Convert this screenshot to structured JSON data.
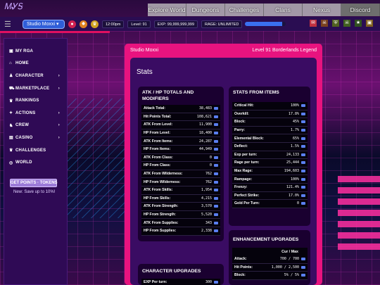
{
  "banner": {
    "logo": "ᎷᎽᎦ"
  },
  "topnav": [
    "Explore World",
    "Dungeons",
    "Challenges",
    "Clans",
    "Nexus",
    "Discord"
  ],
  "header": {
    "studio": "Studio Moxxi ▾",
    "time": "12:00pm",
    "level": "Level: 91",
    "exp": "EXP: 99,999,999,999",
    "rage": "RAGE: UNLIMITED",
    "rage_fill": 0.9
  },
  "sidebar": {
    "items": [
      {
        "icon": "▣",
        "label": "MY RGA",
        "chevron": ""
      },
      {
        "icon": "⌂",
        "label": "HOME",
        "chevron": ""
      },
      {
        "icon": "♟",
        "label": "CHARACTER",
        "chevron": "›"
      },
      {
        "icon": "⛟",
        "label": "MARKETPLACE",
        "chevron": "›"
      },
      {
        "icon": "♛",
        "label": "RANKINGS",
        "chevron": ""
      },
      {
        "icon": "✦",
        "label": "ACTIONS",
        "chevron": "›"
      },
      {
        "icon": "♞",
        "label": "CREW",
        "chevron": "›"
      },
      {
        "icon": "▤",
        "label": "CASINO",
        "chevron": "›"
      },
      {
        "icon": "♛",
        "label": "CHALLENGES",
        "chevron": ""
      },
      {
        "icon": "◎",
        "label": "WORLD",
        "chevron": ""
      }
    ],
    "points_button": "GET POINTS · TOKENS",
    "save_text": "New: Save up to 10%!"
  },
  "main": {
    "studio_name": "Studio Moxxi",
    "level_line": "Level 91 Borderlands Legend",
    "stats_title": "Stats",
    "atk_card": {
      "title_line1": "ATK / HP TOTALS AND",
      "title_line2": "MODIFIERS",
      "rows": [
        {
          "label": "Attack Total:",
          "value": "38,483"
        },
        {
          "label": "Hit Points Total:",
          "value": "108,621"
        },
        {
          "label": "ATK From Level:",
          "value": "11,900"
        },
        {
          "label": "HP From Level:",
          "value": "18,400"
        },
        {
          "label": "ATK From Items:",
          "value": "24,287"
        },
        {
          "label": "HP From Items:",
          "value": "44,949"
        },
        {
          "label": "ATK From Class:",
          "value": "0"
        },
        {
          "label": "HP From Class:",
          "value": "0"
        },
        {
          "label": "ATK From Wilderness:",
          "value": "762"
        },
        {
          "label": "HP From Wilderness:",
          "value": "762"
        },
        {
          "label": "ATK From Skills:",
          "value": "1,954"
        },
        {
          "label": "HP From Skills:",
          "value": "4,215"
        },
        {
          "label": "ATK From Strength:",
          "value": "3,570"
        },
        {
          "label": "HP From Strength:",
          "value": "5,520"
        },
        {
          "label": "ATK From Supplies:",
          "value": "343"
        },
        {
          "label": "HP From Supplies:",
          "value": "2,338"
        }
      ]
    },
    "char_upgrades": {
      "title": "CHARACTER UPGRADES",
      "rows": [
        {
          "label": "EXP Per turn:",
          "value": "300"
        }
      ]
    },
    "items_card": {
      "title": "STATS FROM ITEMS",
      "rows": [
        {
          "label": "Critical Hit:",
          "value": "100%"
        },
        {
          "label": "Overkill:",
          "value": "17.8%"
        },
        {
          "label": "Block:",
          "value": "45%"
        },
        {
          "label": "Parry:",
          "value": "1.7%"
        },
        {
          "label": "Elemental Block:",
          "value": "65%"
        },
        {
          "label": "Deflect:",
          "value": "1.5%"
        },
        {
          "label": "Exp per turn:",
          "value": "24,133"
        },
        {
          "label": "Rage per turn:",
          "value": "25,444"
        },
        {
          "label": "Max Rage:",
          "value": "194,603"
        },
        {
          "label": "Rampage:",
          "value": "100%"
        },
        {
          "label": "Frenzy:",
          "value": "121.4%"
        },
        {
          "label": "Perfect Strike:",
          "value": "17.0%"
        },
        {
          "label": "Gold Per Turn:",
          "value": "0"
        }
      ]
    },
    "enh_card": {
      "title": "ENHANCEMENT UPGRADES",
      "col_header": "Cur / Max",
      "rows": [
        {
          "label": "Attack:",
          "value": "700 / 700"
        },
        {
          "label": "Hit Points:",
          "value": "1,000 / 2,500"
        },
        {
          "label": "Block:",
          "value": "5% / 5%"
        }
      ]
    }
  }
}
